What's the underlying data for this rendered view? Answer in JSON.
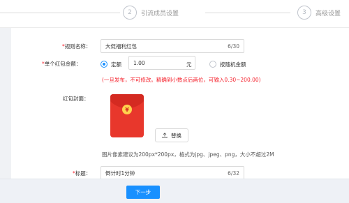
{
  "steps": [
    {
      "number": "2",
      "label": "引流成员设置"
    },
    {
      "number": "3",
      "label": "高级设置"
    }
  ],
  "form": {
    "rule_name": {
      "required_mark": "*",
      "label": "规则名称：",
      "value": "大促福利红包",
      "counter": "6/30"
    },
    "amount": {
      "required_mark": "*",
      "label": "单个红包金额：",
      "options": [
        {
          "label": "定额",
          "checked": true
        },
        {
          "label": "按随机金额",
          "checked": false
        }
      ],
      "value": "1.00",
      "unit": "元",
      "hint": "(一旦发布，不可修改。精确到小数点后两位，可输入0.30~200.00)"
    },
    "cover": {
      "label": "红包封面：",
      "coin_symbol": "¥",
      "replace_label": "替换",
      "hint": "图片像素建议为200px*200px，格式为jpg、jpeg、png，大小不超过2M"
    },
    "title": {
      "required_mark": "*",
      "label": "标题：",
      "value": "倒计时1分钟",
      "counter": "6/32"
    }
  },
  "footer": {
    "next_label": "下一步"
  },
  "colors": {
    "primary": "#1890ff",
    "danger": "#f5222d",
    "cover_red": "#e8372c",
    "coin_gold": "#ffd34d"
  },
  "icons": [
    "upload-icon",
    "yuan-coin-icon"
  ]
}
